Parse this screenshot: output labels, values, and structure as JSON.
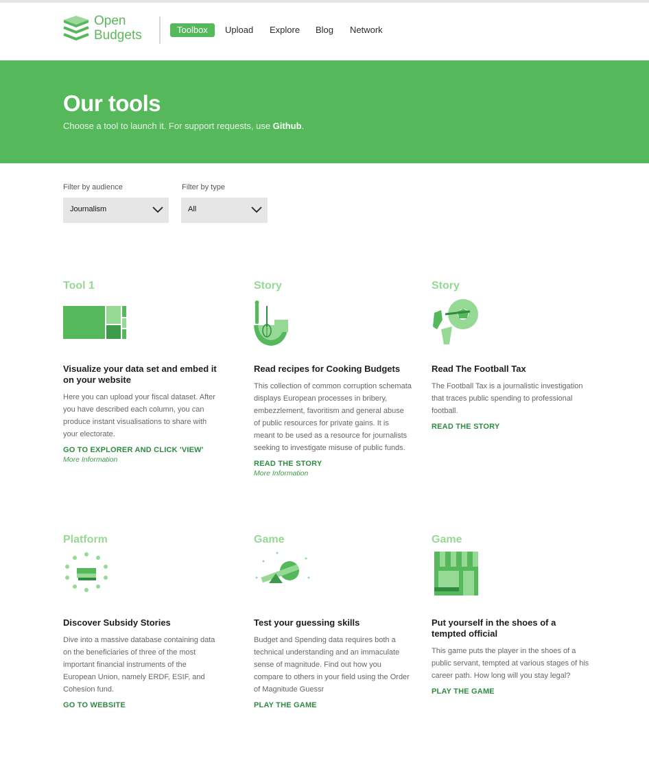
{
  "header": {
    "logo_line1": "Open",
    "logo_line2": "Budgets",
    "nav": [
      "Toolbox",
      "Upload",
      "Explore",
      "Blog",
      "Network"
    ]
  },
  "hero": {
    "title": "Our tools",
    "subtitle": "Choose a tool to launch it. For support requests, use ",
    "subtitle_link": "Github",
    "subtitle_end": "."
  },
  "filters": {
    "audience_label": "Filter by audience",
    "audience_value": "Journalism",
    "type_label": "Filter by type",
    "type_value": "All"
  },
  "cards": [
    {
      "category": "Tool 1",
      "icon": "treemap-icon",
      "title": "Visualize your data set and embed it on your website",
      "description": "Here you can upload your fiscal dataset. After you have described each column, you can produce instant visualisations to share with your electorate.",
      "link": "GO TO EXPLORER AND CLICK 'VIEW'",
      "more": "More Information"
    },
    {
      "category": "Story",
      "icon": "cooking-icon",
      "title": "Read recipes for Cooking Budgets",
      "description": "This collection of common corruption schemata displays European processes in bribery, embezzlement, favoritism and general abuse of public resources for private gains. It is meant to be used as a resource for journalists seeking to investigate misuse of public funds.",
      "link": "READ THE STORY",
      "more": "More Information"
    },
    {
      "category": "Story",
      "icon": "football-icon",
      "title": "Read The Football Tax",
      "description": "The Football Tax is a journalistic investigation that traces public spending to professional football.",
      "link": "READ THE STORY",
      "more": ""
    },
    {
      "category": "Platform",
      "icon": "eu-stars-money-icon",
      "title": "Discover Subsidy Stories",
      "description": "Dive into a massive database containing data on the beneficiaries of three of the most important financial instruments of the European Union, namely ERDF, ESIF, and Cohesion fund.",
      "link": "GO TO WEBSITE",
      "more": ""
    },
    {
      "category": "Game",
      "icon": "magnitude-scale-icon",
      "title": "Test your guessing skills",
      "description": "Budget and Spending data requires both a technical understanding and an immaculate sense of magnitude. Find out how you compare to others in your field using the Order of Magnitude Guessr",
      "link": "PLAY THE GAME",
      "more": ""
    },
    {
      "category": "Game",
      "icon": "shop-icon",
      "title": "Put yourself in the shoes of a tempted official",
      "description": "This game puts the player in the shoes of a public servant, tempted at various stages of his career path. How long will you stay legal?",
      "link": "PLAY THE GAME",
      "more": ""
    }
  ],
  "colors": {
    "brand_green": "#55b95c",
    "light_green": "#95d995",
    "link_green": "#2e8b3f"
  }
}
